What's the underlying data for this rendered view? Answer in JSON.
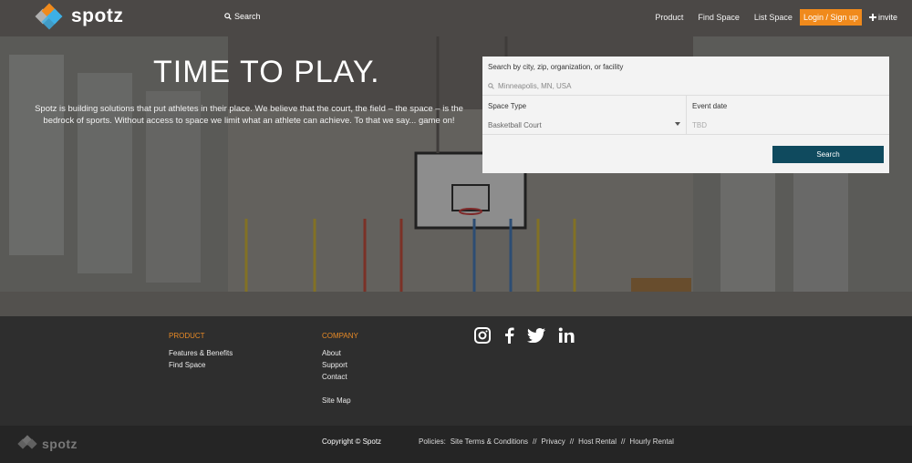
{
  "brand": {
    "name": "spotz",
    "colors": {
      "accent": "#f08a1c",
      "button": "#0f4a5e",
      "logo_blue": "#3db0e6",
      "logo_orange": "#f08a1c",
      "logo_gray": "#b0b0b0"
    }
  },
  "nav": {
    "search_label": "Search",
    "links": [
      "Product",
      "Find Space",
      "List Space"
    ],
    "login_label": "Login / Sign up",
    "invite_label": "invite"
  },
  "hero": {
    "title": "TIME TO PLAY.",
    "text": "Spotz is building solutions that put athletes in their place. We believe that the court, the field – the space – is the bedrock of sports. Without access to space we limit what an athlete can achieve. To that we say... game on!"
  },
  "search_form": {
    "location_label": "Search by city, zip, organization, or facility",
    "location_placeholder": "Minneapolis, MN, USA",
    "space_type_label": "Space Type",
    "space_type_value": "Basketball Court",
    "event_date_label": "Event date",
    "event_date_placeholder": "TBD",
    "submit_label": "Search"
  },
  "footer": {
    "product": {
      "heading": "PRODUCT",
      "items": [
        "Features & Benefits",
        "Find Space"
      ]
    },
    "company": {
      "heading": "COMPANY",
      "items": [
        "About",
        "Support",
        "Contact"
      ],
      "extra": "Site Map"
    },
    "social": [
      "instagram-icon",
      "facebook-icon",
      "twitter-icon",
      "linkedin-icon"
    ]
  },
  "bottom_bar": {
    "logo_text": "spotz",
    "copyright": "Copyright © Spotz",
    "policies_label": "Policies:",
    "policies": [
      "Site Terms & Conditions",
      "Privacy",
      "Host Rental",
      "Hourly Rental"
    ],
    "separator": "//"
  }
}
